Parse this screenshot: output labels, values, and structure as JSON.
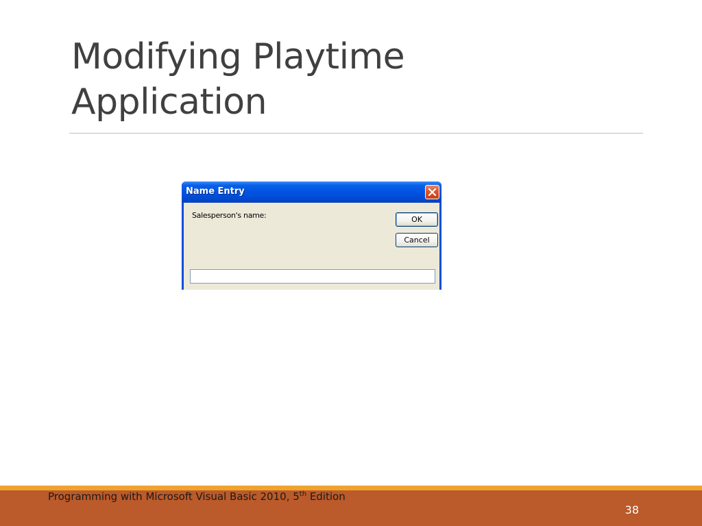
{
  "slide": {
    "title_line1": "Modifying Playtime",
    "title_line2": "Application"
  },
  "dialog": {
    "title": "Name Entry",
    "prompt": "Salesperson's name:",
    "ok_label": "OK",
    "cancel_label": "Cancel",
    "input_value": "",
    "close_icon": "close-icon"
  },
  "footer": {
    "text_main": "Programming with Microsoft Visual Basic 2010, 5",
    "text_sup": "th",
    "text_end": " Edition",
    "page_number": "38"
  },
  "colors": {
    "title_text": "#404040",
    "footer_bar": "#bb5a2a",
    "footer_accent": "#f0a22e",
    "xp_titlebar": "#0054e3",
    "xp_body": "#ece9d8",
    "xp_close": "#d8562e"
  }
}
